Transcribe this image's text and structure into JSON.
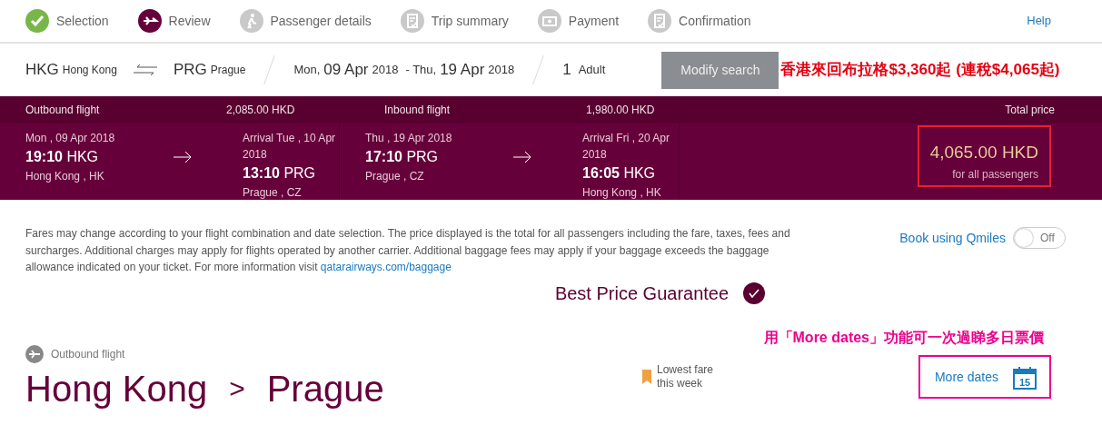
{
  "steps": [
    {
      "label": "Selection",
      "kind": "done"
    },
    {
      "label": "Review",
      "kind": "current"
    },
    {
      "label": "Passenger details",
      "kind": "pending"
    },
    {
      "label": "Trip summary",
      "kind": "pending"
    },
    {
      "label": "Payment",
      "kind": "pending"
    },
    {
      "label": "Confirmation",
      "kind": "pending"
    }
  ],
  "help": "Help",
  "search": {
    "from_code": "HKG",
    "from_city": "Hong Kong",
    "to_code": "PRG",
    "to_city": "Prague",
    "depart_day": "Mon,",
    "depart_date": "09 Apr",
    "depart_year": "2018",
    "return_day": "- Thu,",
    "return_date": "19 Apr",
    "return_year": "2018",
    "pax_count": "1",
    "pax_label": "Adult",
    "button": "Modify search"
  },
  "annotation_top": "香港來回布拉格$3,360起 (連稅$4,065起)",
  "summary": {
    "outbound_label": "Outbound flight",
    "outbound_price": "2,085.00 HKD",
    "inbound_label": "Inbound flight",
    "inbound_price": "1,980.00 HKD",
    "total_label": "Total price",
    "legs": [
      {
        "dep_date": "Mon , 09 Apr 2018",
        "dep_time": "19:10",
        "dep_code": "HKG",
        "dep_place": "Hong Kong , HK",
        "arr_date": "Arrival Tue , 10 Apr 2018",
        "arr_time": "13:10",
        "arr_code": "PRG",
        "arr_place": "Prague , CZ"
      },
      {
        "dep_date": "Thu , 19 Apr 2018",
        "dep_time": "17:10",
        "dep_code": "PRG",
        "dep_place": "Prague , CZ",
        "arr_date": "Arrival Fri , 20 Apr 2018",
        "arr_time": "16:05",
        "arr_code": "HKG",
        "arr_place": "Hong Kong , HK"
      }
    ],
    "total": "4,065.00 HKD",
    "total_note": "for all passengers"
  },
  "notice": "Fares may change according to your flight combination and date selection. The price displayed is the total for all passengers including the fare, taxes, fees and surcharges. Additional charges may apply for flights operated by another carrier. Additional baggage fees may apply if your baggage exceeds the baggage allowance indicated on your ticket. For more information visit",
  "notice_link": "qatarairways.com/baggage",
  "qmiles": {
    "label": "Book using Qmiles",
    "on": false,
    "state_text": "Off"
  },
  "guarantee": "Best Price Guarantee",
  "outbound": {
    "label": "Outbound flight",
    "from": "Hong Kong",
    "sep": ">",
    "to": "Prague",
    "lowest": "Lowest fare this week",
    "more_dates": "More dates",
    "calendar_day": "15"
  },
  "annotation_bottom": "用「More dates」功能可一次過睇多日票價"
}
